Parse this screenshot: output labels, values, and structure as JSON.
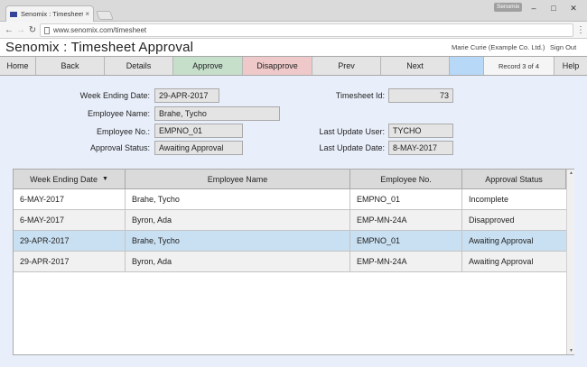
{
  "browser": {
    "tab_title": "Senomix : Timesheet Ap",
    "tab_close": "×",
    "user_chip": "Senomix",
    "url": "www.senomix.com/timesheet",
    "back_icon": "←",
    "forward_icon": "→",
    "reload_icon": "↻",
    "menu_icon": "⋮",
    "minimize": "–",
    "maximize": "□",
    "close": "✕"
  },
  "app": {
    "title": "Senomix : Timesheet Approval",
    "user": "Marie Curie   (Example Co. Ltd.)",
    "sign_out": "Sign Out"
  },
  "toolbar": {
    "home": "Home",
    "back": "Back",
    "details": "Details",
    "approve": "Approve",
    "disapprove": "Disapprove",
    "prev": "Prev",
    "next": "Next",
    "record": "Record 3 of 4",
    "help": "Help"
  },
  "form": {
    "week_ending_label": "Week Ending Date:",
    "week_ending_value": "29-APR-2017",
    "employee_name_label": "Employee Name:",
    "employee_name_value": "Brahe, Tycho",
    "employee_no_label": "Employee No.:",
    "employee_no_value": "EMPNO_01",
    "approval_status_label": "Approval Status:",
    "approval_status_value": "Awaiting Approval",
    "timesheet_id_label": "Timesheet Id:",
    "timesheet_id_value": "73",
    "last_update_user_label": "Last Update User:",
    "last_update_user_value": "TYCHO",
    "last_update_date_label": "Last Update Date:",
    "last_update_date_value": "8-MAY-2017"
  },
  "grid": {
    "sort_icon": "▼",
    "columns": [
      "Week Ending Date",
      "Employee Name",
      "Employee No.",
      "Approval Status"
    ],
    "rows": [
      [
        "6-MAY-2017",
        "Brahe, Tycho",
        "EMPNO_01",
        "Incomplete"
      ],
      [
        "6-MAY-2017",
        "Byron, Ada",
        "EMP-MN-24A",
        "Disapproved"
      ],
      [
        "29-APR-2017",
        "Brahe, Tycho",
        "EMPNO_01",
        "Awaiting Approval"
      ],
      [
        "29-APR-2017",
        "Byron, Ada",
        "EMP-MN-24A",
        "Awaiting Approval"
      ]
    ],
    "selected_row_index": 2
  },
  "colors": {
    "approve": "#c5dfcb",
    "disapprove": "#efc9c9",
    "selected_row": "#c9e0f2",
    "background": "#e9effa"
  }
}
